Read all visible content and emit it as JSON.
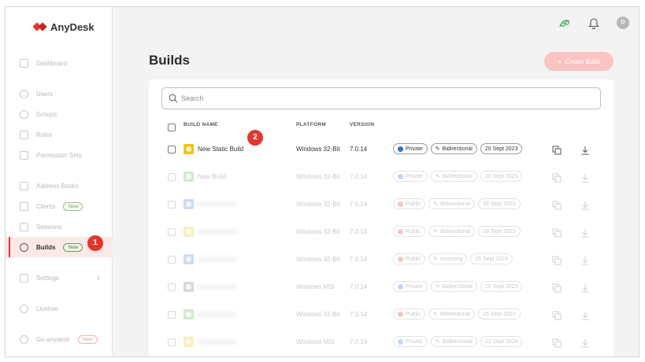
{
  "app": {
    "brand": "AnyDesk",
    "accent": "#e2372d"
  },
  "sidebar": {
    "items": [
      {
        "label": "Dashboard"
      },
      {
        "label": "Users"
      },
      {
        "label": "Groups"
      },
      {
        "label": "Roles"
      },
      {
        "label": "Permission Sets"
      },
      {
        "label": "Address Books"
      },
      {
        "label": "Clients",
        "badge": "New"
      },
      {
        "label": "Sessions"
      },
      {
        "label": "Builds",
        "badge": "New",
        "active": true
      },
      {
        "label": "Settings"
      },
      {
        "label": "License"
      },
      {
        "label": "Go.anydesk",
        "badge": "New"
      }
    ]
  },
  "topbar": {
    "avatar_initial": "D"
  },
  "page": {
    "title": "Builds",
    "create_label": "Create Build"
  },
  "search": {
    "placeholder": "Search"
  },
  "table": {
    "headers": {
      "name": "BUILD NAME",
      "platform": "PLATFORM",
      "version": "VERSION"
    },
    "rows": [
      {
        "name": "New Static Build",
        "icon_color": "#f2c21b",
        "platform": "Windows 32-Bit",
        "version": "7.0.14",
        "access": "Private",
        "access_color": "#2f6fd6",
        "mode": "Bidirectional",
        "date": "20 Sept 2023"
      },
      {
        "name": "New Build",
        "icon_color": "#5cbb4a",
        "platform": "Windows 32-Bit",
        "version": "7.0.14",
        "access": "Private",
        "access_color": "#2f6fd6",
        "mode": "Bidirectional",
        "date": "20 Sept 2023"
      },
      {
        "name": "",
        "icon_color": "#4b7fd6",
        "platform": "Windows 32-Bit",
        "version": "7.0.14",
        "access": "Public",
        "access_color": "#e2372d",
        "mode": "Bidirectional",
        "date": "18 Sept 2023"
      },
      {
        "name": "",
        "icon_color": "#f2c21b",
        "platform": "Windows 32-Bit",
        "version": "7.0.14",
        "access": "Public",
        "access_color": "#e2372d",
        "mode": "Bidirectional",
        "date": "18 Sept 2023"
      },
      {
        "name": "",
        "icon_color": "#4b7fd6",
        "platform": "Windows 32-Bit",
        "version": "7.0.14",
        "access": "Public",
        "access_color": "#e2372d",
        "mode": "Incoming",
        "date": "15 Sept 2023"
      },
      {
        "name": "",
        "icon_color": "#7a7a7a",
        "platform": "Windows MSI",
        "version": "7.0.14",
        "access": "Private",
        "access_color": "#2f6fd6",
        "mode": "Bidirectional",
        "date": "15 Sept 2023"
      },
      {
        "name": "",
        "icon_color": "#5cbb4a",
        "platform": "Windows 32-Bit",
        "version": "7.0.14",
        "access": "Public",
        "access_color": "#e2372d",
        "mode": "Bidirectional",
        "date": "15 Sept 2023"
      },
      {
        "name": "",
        "icon_color": "#f2c21b",
        "platform": "Windows MSI",
        "version": "7.0.14",
        "access": "Private",
        "access_color": "#2f6fd6",
        "mode": "Bidirectional",
        "date": "13 Sept 2023"
      }
    ]
  },
  "callouts": {
    "one": "1",
    "two": "2"
  }
}
